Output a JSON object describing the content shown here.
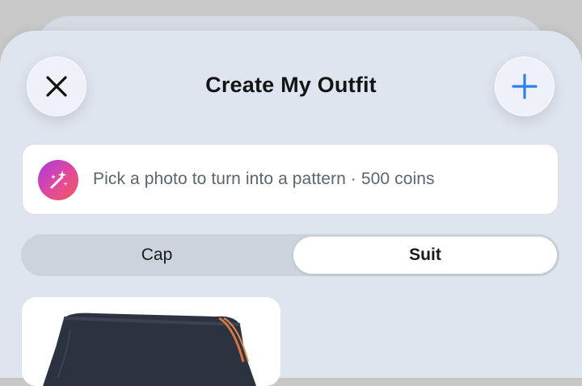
{
  "header": {
    "title": "Create My Outfit",
    "close_icon": "close-icon",
    "add_icon": "plus-icon"
  },
  "promo": {
    "text": "Pick a photo to turn into a pattern · 500 coins",
    "icon": "magic-wand-sparkles-icon"
  },
  "segments": {
    "items": [
      {
        "label": "Cap",
        "selected": false
      },
      {
        "label": "Suit",
        "selected": true
      }
    ]
  },
  "gallery": {
    "items": [
      {
        "image": "dark-navy-shorts-with-orange-piping"
      }
    ]
  },
  "colors": {
    "accent_blue": "#2f7ef0",
    "sheet_bg": "#dfe5ef",
    "promo_gradient_start": "#a93ae0",
    "promo_gradient_end": "#f05a5a",
    "shorts_navy": "#2c3340",
    "shorts_piping": "#d9743c"
  }
}
